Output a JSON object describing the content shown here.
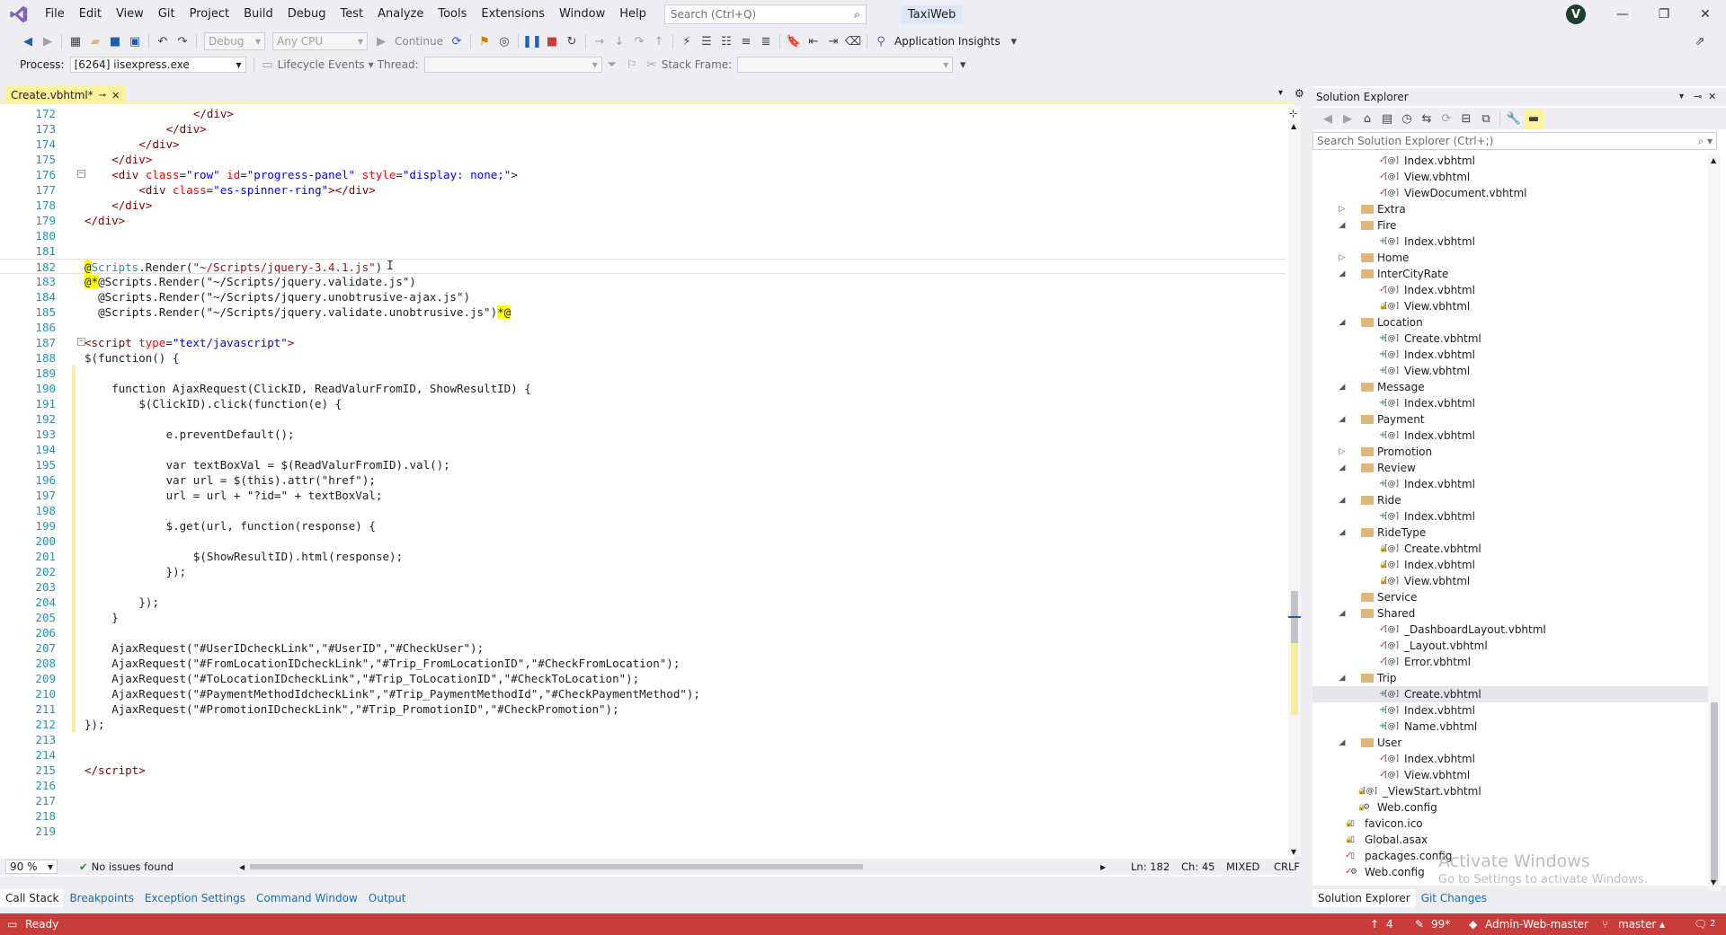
{
  "menu": {
    "items": [
      "File",
      "Edit",
      "View",
      "Git",
      "Project",
      "Build",
      "Debug",
      "Test",
      "Analyze",
      "Tools",
      "Extensions",
      "Window",
      "Help"
    ],
    "search_placeholder": "Search (Ctrl+Q)",
    "solution_name": "TaxiWeb",
    "avatar_initial": "V"
  },
  "toolbar": {
    "config": "Debug",
    "platform": "Any CPU",
    "continue": "Continue",
    "app_insights": "Application Insights"
  },
  "debugbar": {
    "process_label": "Process:",
    "process_value": "[6264] iisexpress.exe",
    "lifecycle": "Lifecycle Events",
    "thread_label": "Thread:",
    "stack_frame_label": "Stack Frame:"
  },
  "editor": {
    "tab_name": "Create.vbhtml*",
    "zoom": "90 %",
    "issues": "No issues found",
    "ln": "Ln: 182",
    "ch": "Ch: 45",
    "mixed": "MIXED",
    "eol": "CRLF",
    "lines": [
      {
        "n": "172",
        "indent": 16,
        "html": "<span class='tag'>&lt;/div&gt;</span>"
      },
      {
        "n": "173",
        "indent": 12,
        "html": "<span class='tag'>&lt;/div&gt;</span>"
      },
      {
        "n": "174",
        "indent": 8,
        "html": "<span class='tag'>&lt;/div&gt;</span>"
      },
      {
        "n": "175",
        "indent": 4,
        "html": "<span class='tag'>&lt;/div&gt;</span>"
      },
      {
        "n": "176",
        "indent": 4,
        "html": "<span class='tag'>&lt;div</span> <span class='attr'>class</span>=<span class='kw'>\"row\"</span> <span class='attr'>id</span>=<span class='kw'>\"progress-panel\"</span> <span class='attr'>style</span>=<span class='kw'>\"display: none;\"</span><span class='tag'>&gt;</span>"
      },
      {
        "n": "177",
        "indent": 8,
        "html": "<span class='tag'>&lt;div</span> <span class='attr'>class</span>=<span class='kw'>\"es-spinner-ring\"</span><span class='tag'>&gt;&lt;/div&gt;</span>"
      },
      {
        "n": "178",
        "indent": 4,
        "html": "<span class='tag'>&lt;/div&gt;</span>"
      },
      {
        "n": "179",
        "indent": 0,
        "html": "<span class='tag'>&lt;/div&gt;</span>"
      },
      {
        "n": "180",
        "indent": 0,
        "html": ""
      },
      {
        "n": "181",
        "indent": 0,
        "html": ""
      },
      {
        "n": "182",
        "indent": 0,
        "html": "<span class='razor'>@</span><span style='color:#2b91af'>Scripts</span>.Render(<span class='str'>\"~/Scripts/jquery-3.4.1.js\"</span>)"
      },
      {
        "n": "183",
        "indent": 0,
        "html": "<span class='razor'>@*</span>@Scripts.Render(\"~/Scripts/jquery.validate.js\")"
      },
      {
        "n": "184",
        "indent": 2,
        "html": "@Scripts.Render(\"~/Scripts/jquery.unobtrusive-ajax.js\")"
      },
      {
        "n": "185",
        "indent": 2,
        "html": "@Scripts.Render(\"~/Scripts/jquery.validate.unobtrusive.js\")<span class='razor'>*@</span>"
      },
      {
        "n": "186",
        "indent": 0,
        "html": ""
      },
      {
        "n": "187",
        "indent": 0,
        "html": "<span class='tag'>&lt;script</span> <span class='attr'>type</span>=<span class='kw'>\"text/javascript\"</span><span class='tag'>&gt;</span>"
      },
      {
        "n": "188",
        "indent": 0,
        "html": "$(function() {"
      },
      {
        "n": "189",
        "indent": 0,
        "html": ""
      },
      {
        "n": "190",
        "indent": 4,
        "html": "function AjaxRequest(ClickID, ReadValurFromID, ShowResultID) {"
      },
      {
        "n": "191",
        "indent": 8,
        "html": "$(ClickID).click(function(e) {"
      },
      {
        "n": "192",
        "indent": 0,
        "html": ""
      },
      {
        "n": "193",
        "indent": 12,
        "html": "e.preventDefault();"
      },
      {
        "n": "194",
        "indent": 0,
        "html": ""
      },
      {
        "n": "195",
        "indent": 12,
        "html": "var textBoxVal = $(ReadValurFromID).val();"
      },
      {
        "n": "196",
        "indent": 12,
        "html": "var url = $(this).attr(\"href\");"
      },
      {
        "n": "197",
        "indent": 12,
        "html": "url = url + \"?id=\" + textBoxVal;"
      },
      {
        "n": "198",
        "indent": 0,
        "html": ""
      },
      {
        "n": "199",
        "indent": 12,
        "html": "$.get(url, function(response) {"
      },
      {
        "n": "200",
        "indent": 0,
        "html": ""
      },
      {
        "n": "201",
        "indent": 16,
        "html": "$(ShowResultID).html(response);"
      },
      {
        "n": "202",
        "indent": 12,
        "html": "});"
      },
      {
        "n": "203",
        "indent": 0,
        "html": ""
      },
      {
        "n": "204",
        "indent": 8,
        "html": "});"
      },
      {
        "n": "205",
        "indent": 4,
        "html": "}"
      },
      {
        "n": "206",
        "indent": 0,
        "html": ""
      },
      {
        "n": "207",
        "indent": 4,
        "html": "AjaxRequest(\"#UserIDcheckLink\",\"#UserID\",\"#CheckUser\");"
      },
      {
        "n": "208",
        "indent": 4,
        "html": "AjaxRequest(\"#FromLocationIDcheckLink\",\"#Trip_FromLocationID\",\"#CheckFromLocation\");"
      },
      {
        "n": "209",
        "indent": 4,
        "html": "AjaxRequest(\"#ToLocationIDcheckLink\",\"#Trip_ToLocationID\",\"#CheckToLocation\");"
      },
      {
        "n": "210",
        "indent": 4,
        "html": "AjaxRequest(\"#PaymentMethodIdcheckLink\",\"#Trip_PaymentMethodId\",\"#CheckPaymentMethod\");"
      },
      {
        "n": "211",
        "indent": 4,
        "html": "AjaxRequest(\"#PromotionIDcheckLink\",\"#Trip_PromotionID\",\"#CheckPromotion\");"
      },
      {
        "n": "212",
        "indent": 0,
        "html": "});"
      },
      {
        "n": "213",
        "indent": 0,
        "html": ""
      },
      {
        "n": "214",
        "indent": 0,
        "html": ""
      },
      {
        "n": "215",
        "indent": 0,
        "html": "<span class='tag'>&lt;/script&gt;</span>"
      },
      {
        "n": "216",
        "indent": 0,
        "html": ""
      },
      {
        "n": "217",
        "indent": 0,
        "html": ""
      },
      {
        "n": "218",
        "indent": 0,
        "html": ""
      },
      {
        "n": "219",
        "indent": 0,
        "html": ""
      }
    ]
  },
  "bottom_tabs": [
    "Call Stack",
    "Breakpoints",
    "Exception Settings",
    "Command Window",
    "Output"
  ],
  "solution_explorer": {
    "title": "Solution Explorer",
    "search_placeholder": "Search Solution Explorer (Ctrl+;)",
    "items": [
      {
        "label": "Index.vbhtml",
        "level": 3,
        "kind": "file",
        "mark": "✓"
      },
      {
        "label": "View.vbhtml",
        "level": 3,
        "kind": "file",
        "mark": "✓"
      },
      {
        "label": "ViewDocument.vbhtml",
        "level": 3,
        "kind": "file",
        "mark": "✓"
      },
      {
        "label": "Extra",
        "level": 2,
        "kind": "folder",
        "exp": "▷"
      },
      {
        "label": "Fire",
        "level": 2,
        "kind": "folder",
        "exp": "◢"
      },
      {
        "label": "Index.vbhtml",
        "level": 3,
        "kind": "file",
        "mark": "+"
      },
      {
        "label": "Home",
        "level": 2,
        "kind": "folder",
        "exp": "▷"
      },
      {
        "label": "InterCityRate",
        "level": 2,
        "kind": "folder",
        "exp": "◢"
      },
      {
        "label": "Index.vbhtml",
        "level": 3,
        "kind": "file",
        "mark": "✓"
      },
      {
        "label": "View.vbhtml",
        "level": 3,
        "kind": "file",
        "mark": "🔒"
      },
      {
        "label": "Location",
        "level": 2,
        "kind": "folder",
        "exp": "◢"
      },
      {
        "label": "Create.vbhtml",
        "level": 3,
        "kind": "file",
        "mark": "+"
      },
      {
        "label": "Index.vbhtml",
        "level": 3,
        "kind": "file",
        "mark": "+"
      },
      {
        "label": "View.vbhtml",
        "level": 3,
        "kind": "file",
        "mark": "+"
      },
      {
        "label": "Message",
        "level": 2,
        "kind": "folder",
        "exp": "◢"
      },
      {
        "label": "Index.vbhtml",
        "level": 3,
        "kind": "file",
        "mark": "+"
      },
      {
        "label": "Payment",
        "level": 2,
        "kind": "folder",
        "exp": "◢"
      },
      {
        "label": "Index.vbhtml",
        "level": 3,
        "kind": "file",
        "mark": "+"
      },
      {
        "label": "Promotion",
        "level": 2,
        "kind": "folder",
        "exp": "▷"
      },
      {
        "label": "Review",
        "level": 2,
        "kind": "folder",
        "exp": "◢"
      },
      {
        "label": "Index.vbhtml",
        "level": 3,
        "kind": "file",
        "mark": "+"
      },
      {
        "label": "Ride",
        "level": 2,
        "kind": "folder",
        "exp": "◢"
      },
      {
        "label": "Index.vbhtml",
        "level": 3,
        "kind": "file",
        "mark": "+"
      },
      {
        "label": "RideType",
        "level": 2,
        "kind": "folder",
        "exp": "◢"
      },
      {
        "label": "Create.vbhtml",
        "level": 3,
        "kind": "file",
        "mark": "🔒"
      },
      {
        "label": "Index.vbhtml",
        "level": 3,
        "kind": "file",
        "mark": "🔒"
      },
      {
        "label": "View.vbhtml",
        "level": 3,
        "kind": "file",
        "mark": "🔒"
      },
      {
        "label": "Service",
        "level": 2,
        "kind": "folder",
        "exp": ""
      },
      {
        "label": "Shared",
        "level": 2,
        "kind": "folder",
        "exp": "◢"
      },
      {
        "label": "_DashboardLayout.vbhtml",
        "level": 3,
        "kind": "file",
        "mark": "✓"
      },
      {
        "label": "_Layout.vbhtml",
        "level": 3,
        "kind": "file",
        "mark": "✓"
      },
      {
        "label": "Error.vbhtml",
        "level": 3,
        "kind": "file",
        "mark": "✓"
      },
      {
        "label": "Trip",
        "level": 2,
        "kind": "folder",
        "exp": "◢"
      },
      {
        "label": "Create.vbhtml",
        "level": 3,
        "kind": "file",
        "mark": "+",
        "selected": true
      },
      {
        "label": "Index.vbhtml",
        "level": 3,
        "kind": "file",
        "mark": "+"
      },
      {
        "label": "Name.vbhtml",
        "level": 3,
        "kind": "file",
        "mark": "+"
      },
      {
        "label": "User",
        "level": 2,
        "kind": "folder",
        "exp": "◢"
      },
      {
        "label": "Index.vbhtml",
        "level": 3,
        "kind": "file",
        "mark": "✓"
      },
      {
        "label": "View.vbhtml",
        "level": 3,
        "kind": "file",
        "mark": "✓"
      },
      {
        "label": "_ViewStart.vbhtml",
        "level": 2,
        "kind": "file",
        "mark": "🔒"
      },
      {
        "label": "Web.config",
        "level": 2,
        "kind": "config",
        "mark": "🔒"
      },
      {
        "label": "favicon.ico",
        "level": 1,
        "kind": "file2",
        "mark": "🔒"
      },
      {
        "label": "Global.asax",
        "level": 1,
        "kind": "file2",
        "mark": "🔒"
      },
      {
        "label": "packages.config",
        "level": 1,
        "kind": "file2",
        "mark": "✓"
      },
      {
        "label": "Web.config",
        "level": 1,
        "kind": "config",
        "mark": "✓"
      }
    ],
    "tabs": [
      "Solution Explorer",
      "Git Changes"
    ]
  },
  "watermark": {
    "title": "Activate Windows",
    "sub": "Go to Settings to activate Windows."
  },
  "statusbar": {
    "ready": "Ready",
    "up_count": "4",
    "pencil_count": "99*",
    "repo": "Admin-Web-master",
    "branch": "master",
    "notif": "2"
  },
  "colors": {
    "status_red": "#c93c3c",
    "tab_yellow": "#fff29d",
    "link_blue": "#0e70c0"
  }
}
